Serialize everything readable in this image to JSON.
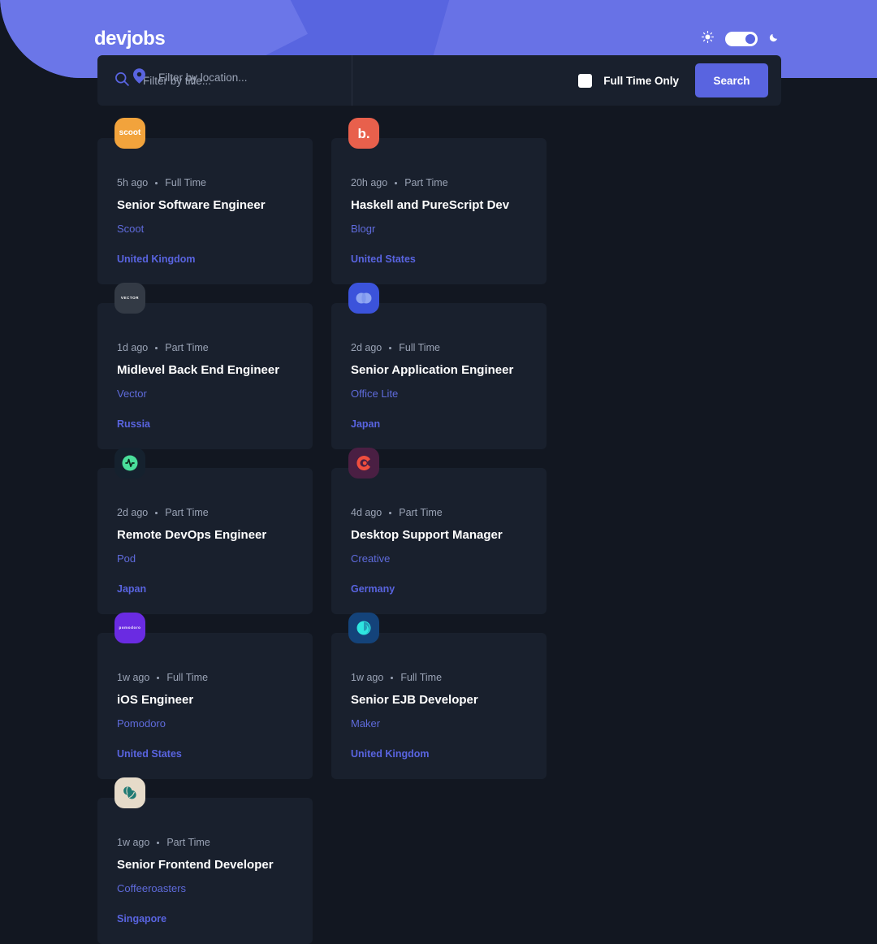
{
  "header": {
    "logo": "devjobs",
    "sun_icon": "sun-icon",
    "moon_icon": "moon-icon",
    "toggle_state": "dark",
    "bg_color": "#5865E0"
  },
  "search": {
    "title_placeholder": "Filter by title...",
    "title_value": "",
    "location_placeholder": "Filter by location...",
    "location_value": "",
    "search_icon": "search-icon",
    "location_icon": "map-pin-icon",
    "fulltime_label": "Full Time Only",
    "fulltime_checked": false,
    "search_label": "Search",
    "accent_color": "#5964E0"
  },
  "jobs": [
    {
      "posted": "5h ago",
      "contract": "Full Time",
      "title": "Senior Software Engineer",
      "company": "Scoot",
      "location": "United Kingdom",
      "logo_text": "scoot",
      "logo_bg": "#F2A33C",
      "logo_style": "wordmark"
    },
    {
      "posted": "20h ago",
      "contract": "Part Time",
      "title": "Haskell and PureScript Dev",
      "company": "Blogr",
      "location": "United States",
      "logo_text": "b.",
      "logo_bg": "#E8604C",
      "logo_style": "letter"
    },
    {
      "posted": "1d ago",
      "contract": "Part Time",
      "title": "Midlevel Back End Engineer",
      "company": "Vector",
      "location": "Russia",
      "logo_text": "VECTOR",
      "logo_bg": "#333A45",
      "logo_style": "tiny-wordmark"
    },
    {
      "posted": "2d ago",
      "contract": "Full Time",
      "title": "Senior Application Engineer",
      "company": "Office Lite",
      "location": "Japan",
      "logo_text": "",
      "logo_bg": "#3B53DB",
      "logo_style": "circles"
    },
    {
      "posted": "2d ago",
      "contract": "Part Time",
      "title": "Remote DevOps Engineer",
      "company": "Pod",
      "location": "Japan",
      "logo_text": "",
      "logo_bg": "#15212E",
      "logo_style": "pulse"
    },
    {
      "posted": "4d ago",
      "contract": "Part Time",
      "title": "Desktop Support Manager",
      "company": "Creative",
      "location": "Germany",
      "logo_text": "",
      "logo_bg": "#4A1F43",
      "logo_style": "c-mark"
    },
    {
      "posted": "1w ago",
      "contract": "Full Time",
      "title": "iOS Engineer",
      "company": "Pomodoro",
      "location": "United States",
      "logo_text": "pomodoro",
      "logo_bg": "#6A2BE2",
      "logo_style": "tiny-wordmark"
    },
    {
      "posted": "1w ago",
      "contract": "Full Time",
      "title": "Senior EJB Developer",
      "company": "Maker",
      "location": "United Kingdom",
      "logo_text": "",
      "logo_bg": "#14437A",
      "logo_style": "swirl"
    },
    {
      "posted": "1w ago",
      "contract": "Part Time",
      "title": "Senior Frontend Developer",
      "company": "Coffeeroasters",
      "location": "Singapore",
      "logo_text": "",
      "logo_bg": "#E6DBC9",
      "logo_style": "beans"
    }
  ]
}
